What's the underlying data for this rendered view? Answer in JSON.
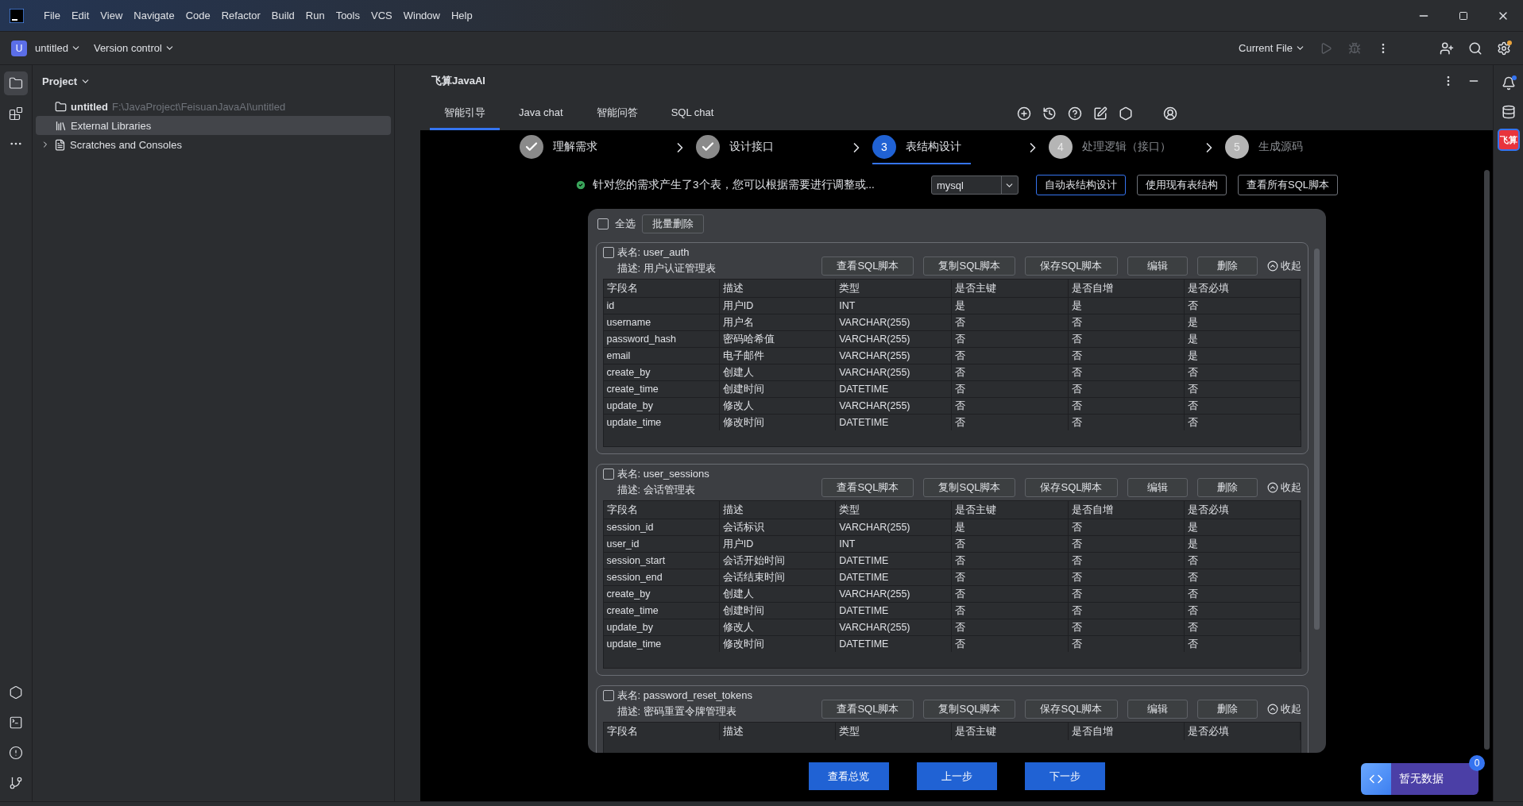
{
  "menu": [
    "File",
    "Edit",
    "View",
    "Navigate",
    "Code",
    "Refactor",
    "Build",
    "Run",
    "Tools",
    "VCS",
    "Window",
    "Help"
  ],
  "toolbar": {
    "project_badge": "U",
    "project": "untitled",
    "vcs": "Version control",
    "run_config": "Current File",
    "run_disabled": true
  },
  "left_strip": {
    "top": [
      {
        "kind": "project",
        "selected": true
      },
      {
        "kind": "structure",
        "selected": false
      },
      {
        "kind": "more",
        "selected": false
      }
    ],
    "bottom": [
      {
        "kind": "services",
        "selected": false
      },
      {
        "kind": "terminal",
        "selected": false
      },
      {
        "kind": "problems",
        "selected": false
      },
      {
        "kind": "git",
        "selected": false
      }
    ]
  },
  "project_panel": {
    "title": "Project",
    "tree": [
      {
        "kind": "module",
        "label": "untitled",
        "path": "F:\\JavaProject\\FeisuanJavaAI\\untitled",
        "selected": false
      },
      {
        "kind": "libraries",
        "label": "External Libraries",
        "selected": true
      },
      {
        "kind": "scratches",
        "label": "Scratches and Consoles",
        "selected": false,
        "expanded": false
      }
    ]
  },
  "plugin": {
    "title": "飞算JavaAI",
    "tabs": [
      {
        "label": "智能引导",
        "selected": true
      },
      {
        "label": "Java chat",
        "selected": false
      },
      {
        "label": "智能问答",
        "selected": false
      },
      {
        "label": "SQL chat",
        "selected": false
      }
    ],
    "steps": [
      {
        "label": "理解需求",
        "kind": "done"
      },
      {
        "label": "设计接口",
        "kind": "done"
      },
      {
        "number": "3",
        "label": "表结构设计",
        "kind": "current"
      },
      {
        "number": "4",
        "label": "处理逻辑（接口）",
        "kind": "todo"
      },
      {
        "number": "5",
        "label": "生成源码",
        "kind": "todo"
      }
    ],
    "notice": "针对您的需求产生了3个表，您可以根据需要进行调整或...",
    "db_select": "mysql",
    "actions": [
      {
        "label": "自动表结构设计",
        "selected": true
      },
      {
        "label": "使用现有表结构",
        "selected": false
      },
      {
        "label": "查看所有SQL脚本",
        "selected": false
      }
    ],
    "select_all": {
      "label": "全选",
      "checked": false
    },
    "batch_delete": "批量删除",
    "tables": [
      {
        "name": "表名: user_auth",
        "description": "描述: 用户认证管理表",
        "checked": false,
        "buttons": [
          "查看SQL脚本",
          "复制SQL脚本",
          "保存SQL脚本",
          "编辑",
          "删除"
        ],
        "collapse": "收起",
        "columns": [
          "字段名",
          "描述",
          "类型",
          "是否主键",
          "是否自增",
          "是否必填"
        ],
        "rows": [
          [
            "id",
            "用户ID",
            "INT",
            "是",
            "是",
            "否"
          ],
          [
            "username",
            "用户名",
            "VARCHAR(255)",
            "否",
            "否",
            "是"
          ],
          [
            "password_hash",
            "密码哈希值",
            "VARCHAR(255)",
            "否",
            "否",
            "是"
          ],
          [
            "email",
            "电子邮件",
            "VARCHAR(255)",
            "否",
            "否",
            "是"
          ],
          [
            "create_by",
            "创建人",
            "VARCHAR(255)",
            "否",
            "否",
            "否"
          ],
          [
            "create_time",
            "创建时间",
            "DATETIME",
            "否",
            "否",
            "否"
          ],
          [
            "update_by",
            "修改人",
            "VARCHAR(255)",
            "否",
            "否",
            "否"
          ],
          [
            "update_time",
            "修改时间",
            "DATETIME",
            "否",
            "否",
            "否"
          ]
        ]
      },
      {
        "name": "表名: user_sessions",
        "description": "描述: 会话管理表",
        "checked": false,
        "buttons": [
          "查看SQL脚本",
          "复制SQL脚本",
          "保存SQL脚本",
          "编辑",
          "删除"
        ],
        "collapse": "收起",
        "columns": [
          "字段名",
          "描述",
          "类型",
          "是否主键",
          "是否自增",
          "是否必填"
        ],
        "rows": [
          [
            "session_id",
            "会话标识",
            "VARCHAR(255)",
            "是",
            "否",
            "是"
          ],
          [
            "user_id",
            "用户ID",
            "INT",
            "否",
            "否",
            "是"
          ],
          [
            "session_start",
            "会话开始时间",
            "DATETIME",
            "否",
            "否",
            "否"
          ],
          [
            "session_end",
            "会话结束时间",
            "DATETIME",
            "否",
            "否",
            "否"
          ],
          [
            "create_by",
            "创建人",
            "VARCHAR(255)",
            "否",
            "否",
            "否"
          ],
          [
            "create_time",
            "创建时间",
            "DATETIME",
            "否",
            "否",
            "否"
          ],
          [
            "update_by",
            "修改人",
            "VARCHAR(255)",
            "否",
            "否",
            "否"
          ],
          [
            "update_time",
            "修改时间",
            "DATETIME",
            "否",
            "否",
            "否"
          ]
        ]
      },
      {
        "name": "表名: password_reset_tokens",
        "description": "描述: 密码重置令牌管理表",
        "checked": false,
        "buttons": [
          "查看SQL脚本",
          "复制SQL脚本",
          "保存SQL脚本",
          "编辑",
          "删除"
        ],
        "collapse": "收起",
        "columns": [
          "字段名",
          "描述",
          "类型",
          "是否主键",
          "是否自增",
          "是否必填"
        ]
      }
    ],
    "nav_buttons": [
      "查看总览",
      "上一步",
      "下一步"
    ],
    "widget": {
      "label": "暂无数据",
      "count": "0"
    }
  },
  "right_strip": {
    "logo": "飞算"
  }
}
